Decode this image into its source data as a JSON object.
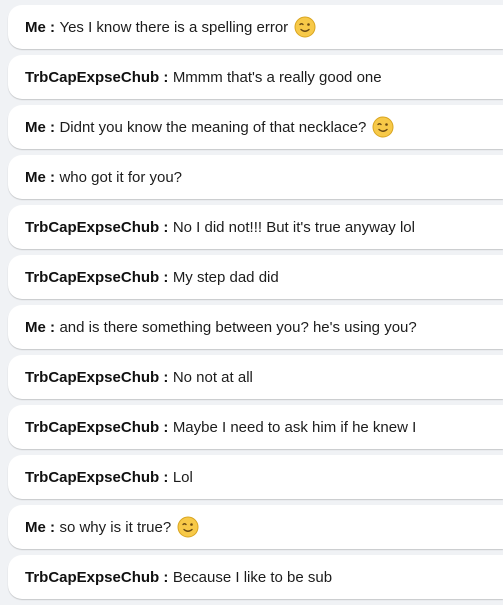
{
  "messages": [
    {
      "sender": "Me :",
      "text": "Yes I know there is a spelling error",
      "emoji": "wink-emoji"
    },
    {
      "sender": "TrbCapExpseChub :",
      "text": "Mmmm that's a really good one",
      "emoji": null
    },
    {
      "sender": "Me :",
      "text": "Didnt you know the meaning of that necklace?",
      "emoji": "wink-emoji"
    },
    {
      "sender": "Me :",
      "text": "who got it for you?",
      "emoji": null
    },
    {
      "sender": "TrbCapExpseChub :",
      "text": "No I did not!!! But it's true anyway lol",
      "emoji": null
    },
    {
      "sender": "TrbCapExpseChub :",
      "text": "My step dad did",
      "emoji": null
    },
    {
      "sender": "Me :",
      "text": "and is there something between you? he's using you?",
      "emoji": null
    },
    {
      "sender": "TrbCapExpseChub :",
      "text": "No not at all",
      "emoji": null
    },
    {
      "sender": "TrbCapExpseChub :",
      "text": "Maybe I need to ask him if he knew I",
      "emoji": null
    },
    {
      "sender": "TrbCapExpseChub :",
      "text": "Lol",
      "emoji": null
    },
    {
      "sender": "Me :",
      "text": "so why is it true?",
      "emoji": "wink-emoji"
    },
    {
      "sender": "TrbCapExpseChub :",
      "text": "Because I like to be sub",
      "emoji": null
    }
  ],
  "colors": {
    "background": "#f0f2f5",
    "bubble": "#ffffff",
    "emoji_face": "#f7c948"
  }
}
